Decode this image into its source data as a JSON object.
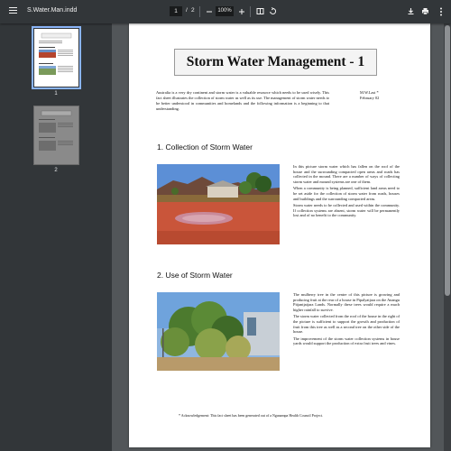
{
  "toolbar": {
    "file_name": "S.Water.Man.indd",
    "current_page": "1",
    "page_sep": "/",
    "total_pages": "2",
    "zoom": "100%",
    "icons": [
      "menu-icon",
      "zoom-out-icon",
      "zoom-in-icon",
      "fit-page-icon",
      "rotate-icon",
      "download-icon",
      "print-icon",
      "more-icon"
    ]
  },
  "sidebar": {
    "thumbnails": [
      {
        "label": "1",
        "selected": true
      },
      {
        "label": "2",
        "selected": false
      }
    ]
  },
  "document": {
    "title": "Storm Water Management - 1",
    "intro": "Australia is a very dry continent and storm water is a valuable resource which needs to be used wisely. This fact sheet illustrates the collection of storm water as well as its use. The management of storm water needs to be better understood in communities and homelands and the following information is a beginning to that understanding.",
    "author_line1": "M.W.Last *",
    "author_line2": "February 02",
    "sections": [
      {
        "heading": "1.  Collection of Storm Water",
        "paragraphs": [
          "In this picture storm water which has fallen on the roof of the house and the surrounding compacted open areas and roads has collected in the mound. There are a number of ways of collecting storm water and mound systems are one of them.",
          "When a community is being planned, sufficient land areas need to be set aside for the collection of storm water from roads, houses and buildings and the surrounding compacted areas.",
          "Storm water needs to be collected and used within the community. If collection systems are absent, storm water will be permanently lost and of no benefit to the community."
        ]
      },
      {
        "heading": "2.  Use of Storm Water",
        "paragraphs": [
          "The mulberry tree in the centre of this picture is growing and producing fruit at the rear of a house in Pipalyatjara on the Anangu Pitjantjatjara Lands. Normally these trees would require a much higher rainfall to survive.",
          "The storm water collected from the roof of the house in the right of the picture is sufficient to support the growth and production of fruit from this tree as well as a second tree on the other side of the house.",
          "The improvement of the storm water collection systems in house yards would support the production of extra fruit trees and vines."
        ]
      }
    ],
    "acknowledgement": "*  Acknowledgement:  This fact sheet has been generated out of a Nganampa Health Council Project."
  },
  "colors": {
    "toolbar_bg": "#323639",
    "viewer_bg": "#525659",
    "selected_thumb_outline": "#8ab4f8"
  }
}
